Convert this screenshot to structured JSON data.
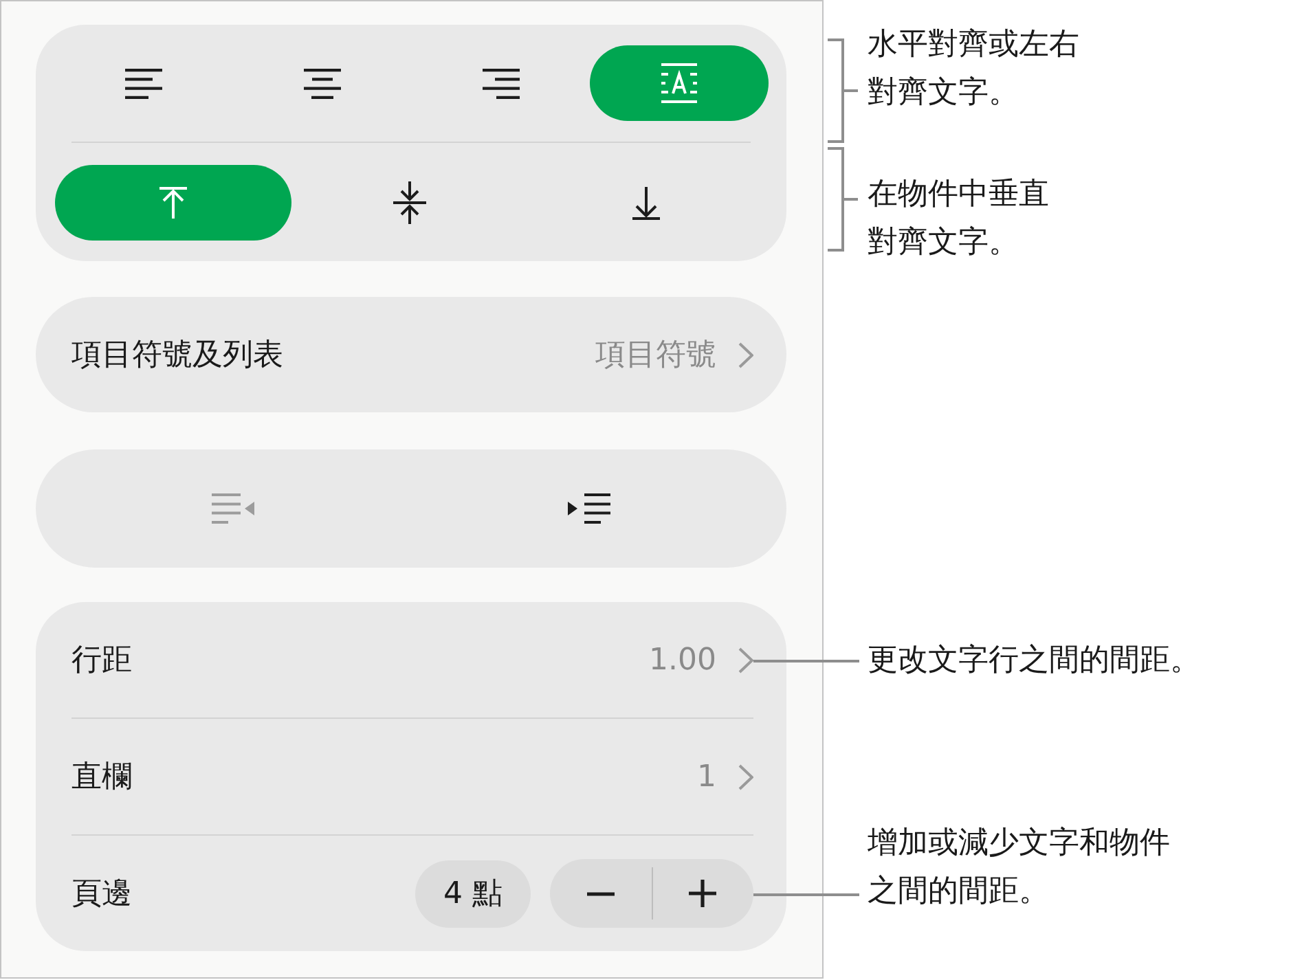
{
  "horizontal_alignment": [
    {
      "kind": "left",
      "selected": false
    },
    {
      "kind": "center",
      "selected": false
    },
    {
      "kind": "right",
      "selected": false
    },
    {
      "kind": "justify",
      "selected": true
    }
  ],
  "vertical_alignment": [
    {
      "kind": "top",
      "selected": true
    },
    {
      "kind": "middle",
      "selected": false
    },
    {
      "kind": "bottom",
      "selected": false
    }
  ],
  "bullets_row": {
    "label": "項目符號及列表",
    "value": "項目符號"
  },
  "indent_buttons": [
    {
      "kind": "outdent",
      "disabled": true
    },
    {
      "kind": "indent",
      "disabled": false
    }
  ],
  "spacing_rows": [
    {
      "kind": "link",
      "label": "行距",
      "value": "1.00"
    },
    {
      "kind": "link",
      "label": "直欄",
      "value": "1"
    },
    {
      "kind": "stepper",
      "label": "頁邊",
      "value": "4 點"
    }
  ],
  "callouts": [
    {
      "kind": "bracket",
      "text": "水平對齊或左右對齊文字。"
    },
    {
      "kind": "bracket",
      "text": "在物件中垂直對齊文字。"
    },
    {
      "kind": "line",
      "text": "更改文字行之間的間距。"
    },
    {
      "kind": "line",
      "text": "增加或減少文字和物件之間的間距。"
    }
  ]
}
